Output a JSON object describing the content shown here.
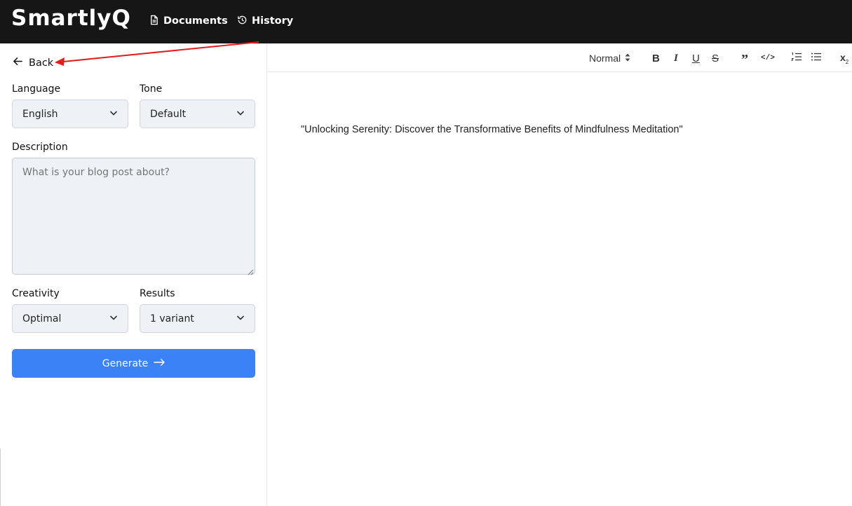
{
  "app": {
    "logo": "SmartlyQ",
    "nav": [
      {
        "label": "Documents",
        "icon": "document-icon"
      },
      {
        "label": "History",
        "icon": "history-icon"
      }
    ]
  },
  "form": {
    "back_label": "Back",
    "language": {
      "label": "Language",
      "value": "English"
    },
    "tone": {
      "label": "Tone",
      "value": "Default"
    },
    "description": {
      "label": "Description",
      "placeholder": "What is your blog post about?",
      "value": ""
    },
    "creativity": {
      "label": "Creativity",
      "value": "Optimal"
    },
    "results": {
      "label": "Results",
      "value": "1 variant"
    },
    "generate_label": "Generate"
  },
  "editor": {
    "toolbar": {
      "heading_select": "Normal",
      "bold": "B",
      "italic": "I",
      "underline": "U",
      "strike": "S",
      "quote": "”",
      "code": "</>",
      "subscript": "x",
      "subscript_mark": "2"
    },
    "content": "\"Unlocking Serenity: Discover the Transformative Benefits of Mindfulness Meditation\""
  },
  "colors": {
    "topbar": "#161616",
    "accent": "#3b82f6",
    "annotation": "#e11d1d"
  }
}
